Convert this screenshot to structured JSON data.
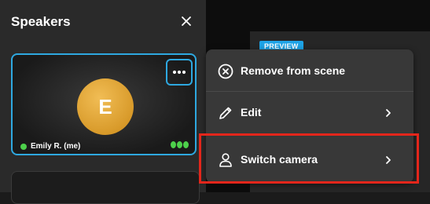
{
  "sidebar": {
    "title": "Speakers",
    "close_icon": "close-icon"
  },
  "speaker": {
    "initial": "E",
    "name": "Emily R. (me)",
    "status": "online",
    "more_icon": "more-horizontal-icon",
    "signal_icon": "signal-strength-icon"
  },
  "stage": {
    "badge": "PREVIEW"
  },
  "menu": {
    "items": [
      {
        "label": "Remove from scene",
        "icon": "remove-circle-icon"
      },
      {
        "label": "Edit",
        "icon": "pencil-icon",
        "chevron": "chevron-right-icon"
      },
      {
        "label": "Switch camera",
        "icon": "person-icon",
        "chevron": "chevron-right-icon"
      }
    ]
  },
  "colors": {
    "accent": "#2ea8e0",
    "highlight": "#e3261b",
    "avatar": "#e2a63a",
    "status": "#4dd04b"
  }
}
